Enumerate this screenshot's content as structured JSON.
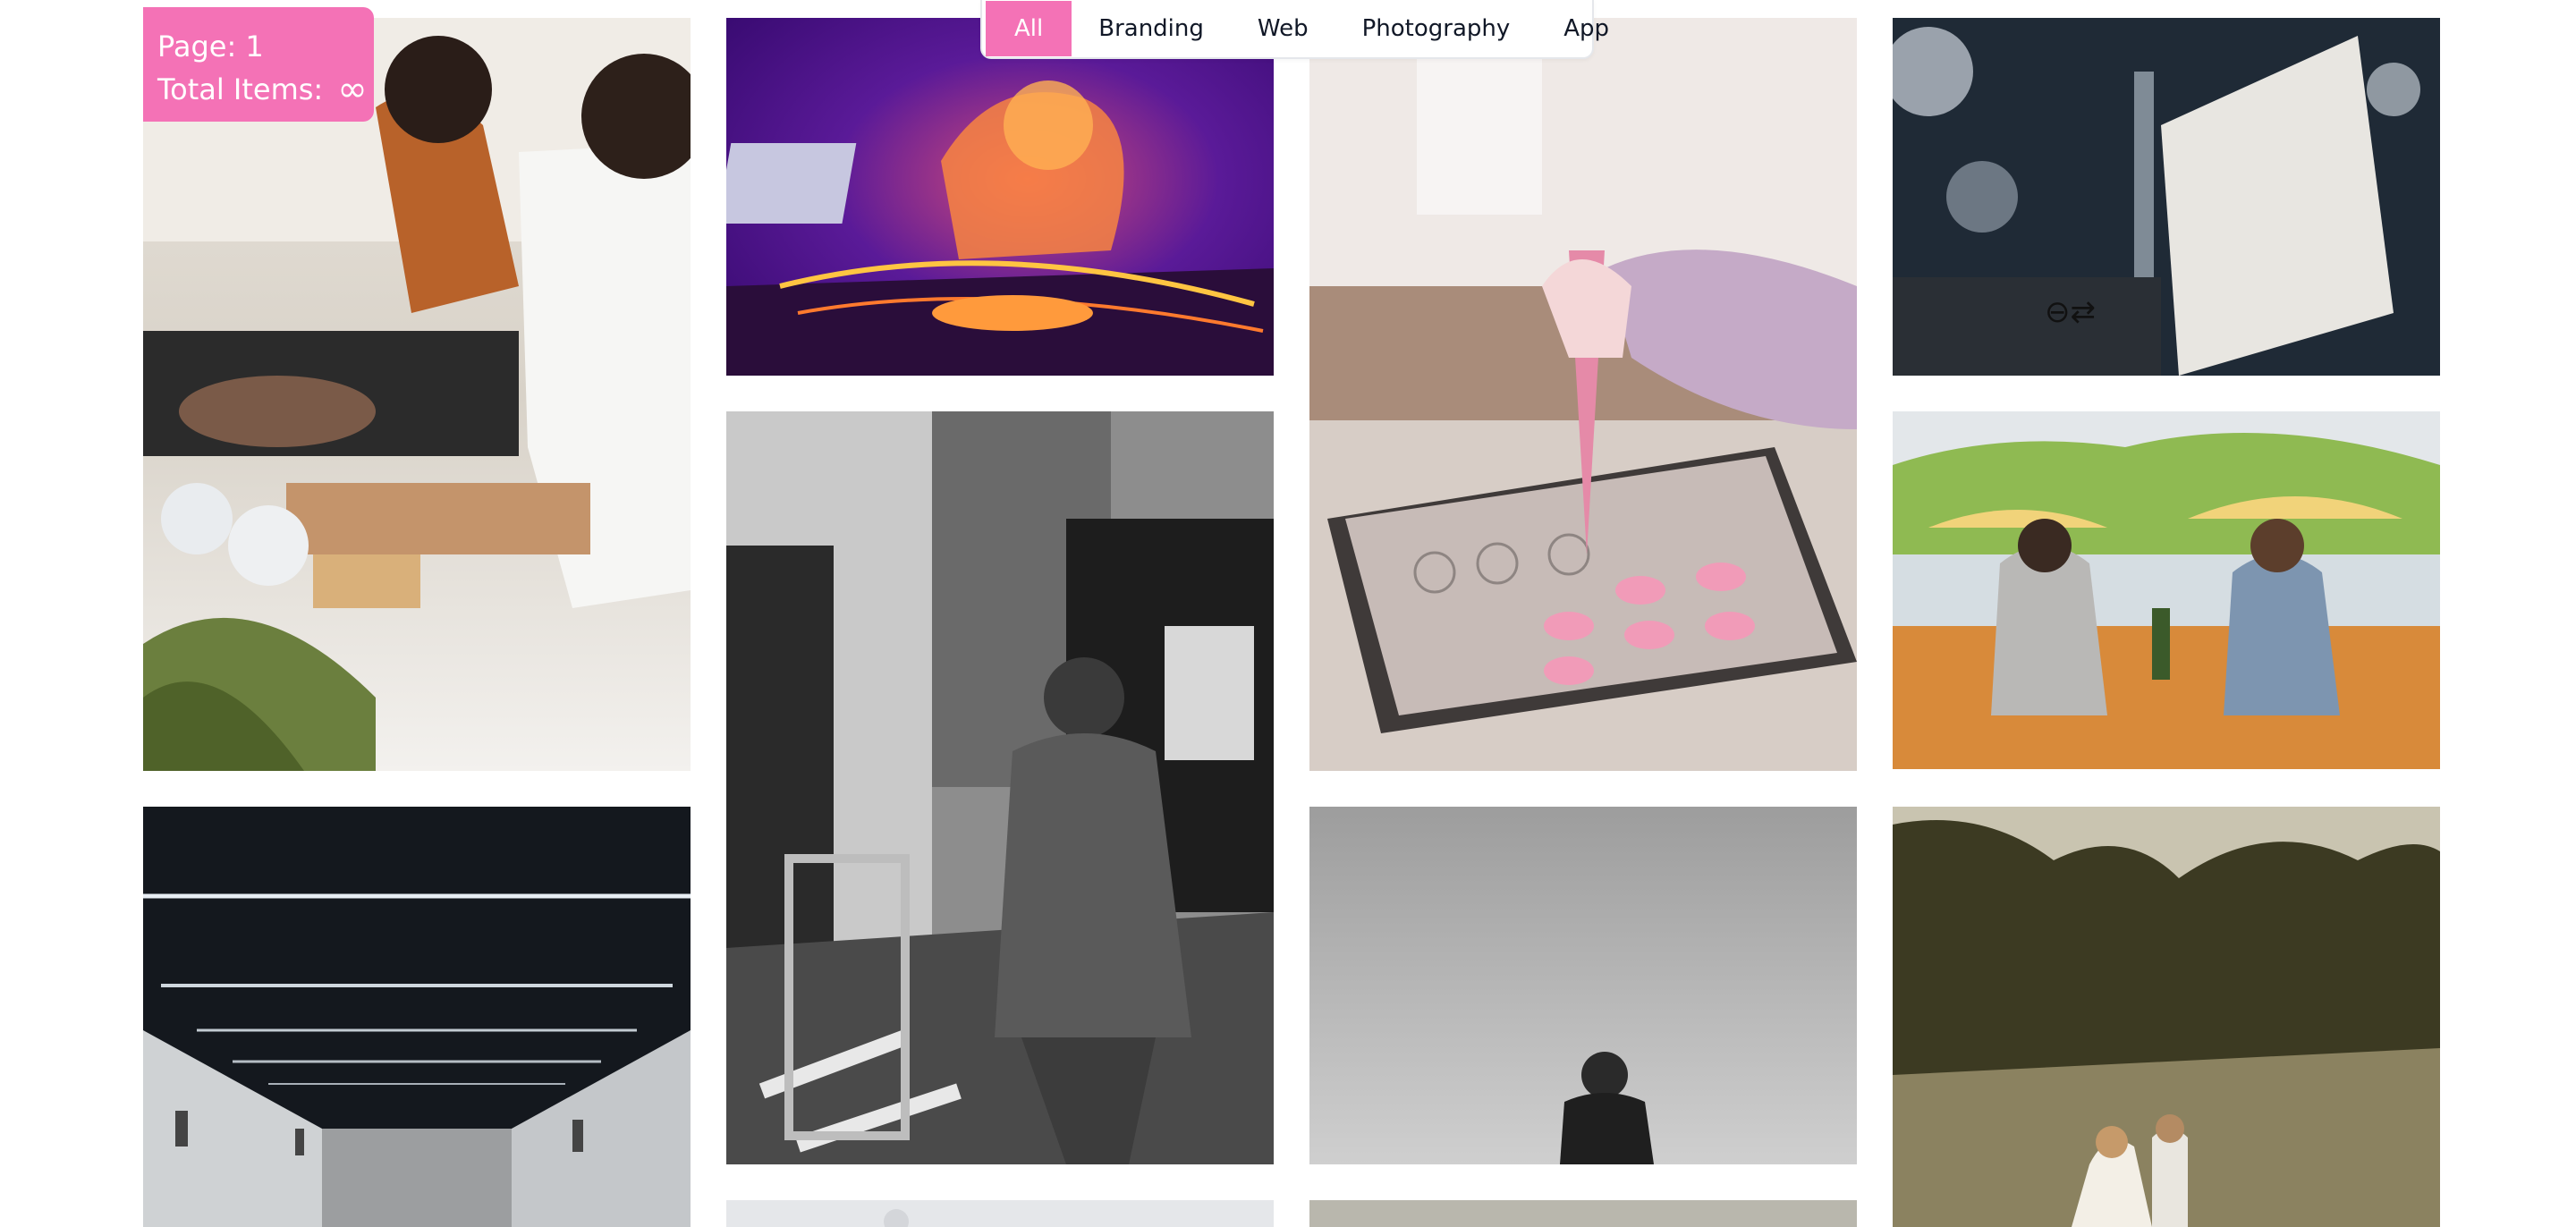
{
  "info": {
    "page_label": "Page: 1",
    "total_label": "Total Items:",
    "total_value": "∞"
  },
  "filters": {
    "items": [
      {
        "label": "All",
        "active": true
      },
      {
        "label": "Branding",
        "active": false
      },
      {
        "label": "Web",
        "active": false
      },
      {
        "label": "Photography",
        "active": false
      },
      {
        "label": "App",
        "active": false
      }
    ]
  },
  "colors": {
    "accent": "#f472b6",
    "background": "#ffffff"
  },
  "gallery": [
    {
      "subject": "couple-cooking-photo"
    },
    {
      "subject": "dj-neon-photo"
    },
    {
      "subject": "piping-macarons-photo"
    },
    {
      "subject": "station-sign-photo"
    },
    {
      "subject": "delivery-worker-bw-photo"
    },
    {
      "subject": "friends-outdoor-table-photo"
    },
    {
      "subject": "tunnel-lights-photo"
    },
    {
      "subject": "lake-person-bw-photo"
    },
    {
      "subject": "wedding-couple-field-photo"
    },
    {
      "subject": "partial-bottom-photo-1"
    },
    {
      "subject": "partial-bottom-photo-2"
    }
  ]
}
